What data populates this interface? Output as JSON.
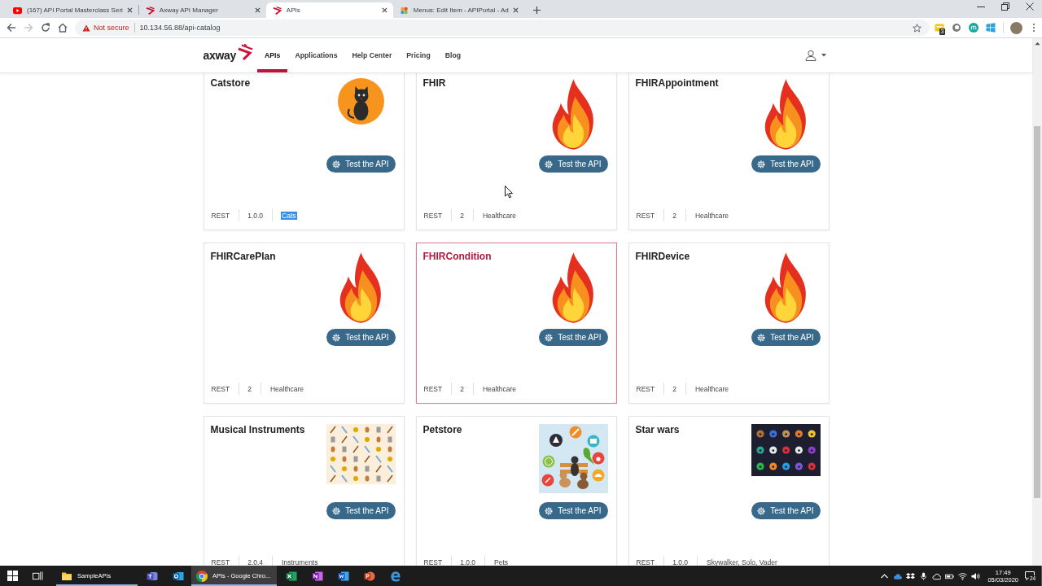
{
  "browser": {
    "tabs": [
      {
        "title": "(167) API Portal Masterclass Seri",
        "kind": "video",
        "selected": false
      },
      {
        "title": "Axway API Manager",
        "kind": "chevron",
        "selected": false
      },
      {
        "title": "APIs",
        "kind": "chevron",
        "selected": true
      },
      {
        "title": "Menus: Edit Item - APIPortal - Ad",
        "kind": "flower",
        "selected": false
      }
    ],
    "forward_disabled": true,
    "security": "Not secure",
    "url": "10.134.56.88/api-catalog",
    "extension_badge": "3"
  },
  "nav": {
    "brand": "axway",
    "items": [
      {
        "label": "APIs",
        "selected": true
      },
      {
        "label": "Applications",
        "selected": false
      },
      {
        "label": "Help Center",
        "selected": false
      },
      {
        "label": "Pricing",
        "selected": false
      },
      {
        "label": "Blog",
        "selected": false
      }
    ]
  },
  "cards": [
    {
      "title": "Catstore",
      "kind": "cat",
      "selected": false,
      "button": "Test the API",
      "type": "REST",
      "version": "1.0.0",
      "tag": "Cats",
      "tag_highlighted": true
    },
    {
      "title": "FHIR",
      "kind": "flame",
      "selected": false,
      "button": "Test the API",
      "type": "REST",
      "version": "2",
      "tag": "Healthcare",
      "tag_highlighted": false
    },
    {
      "title": "FHIRAppointment",
      "kind": "flame",
      "selected": false,
      "button": "Test the API",
      "type": "REST",
      "version": "2",
      "tag": "Healthcare",
      "tag_highlighted": false
    },
    {
      "title": "FHIRCarePlan",
      "kind": "flame",
      "selected": false,
      "button": "Test the API",
      "type": "REST",
      "version": "2",
      "tag": "Healthcare",
      "tag_highlighted": false
    },
    {
      "title": "FHIRCondition",
      "kind": "flame",
      "selected": true,
      "button": "Test the API",
      "type": "REST",
      "version": "2",
      "tag": "Healthcare",
      "tag_highlighted": false
    },
    {
      "title": "FHIRDevice",
      "kind": "flame",
      "selected": false,
      "button": "Test the API",
      "type": "REST",
      "version": "2",
      "tag": "Healthcare",
      "tag_highlighted": false
    },
    {
      "title": "Musical Instruments",
      "kind": "instruments",
      "selected": false,
      "button": "Test the API",
      "type": "REST",
      "version": "2.0.4",
      "tag": "Instruments",
      "tag_highlighted": false
    },
    {
      "title": "Petstore",
      "kind": "pets",
      "selected": false,
      "button": "Test the API",
      "type": "REST",
      "version": "1.0.0",
      "tag": "Pets",
      "tag_highlighted": false
    },
    {
      "title": "Star wars",
      "kind": "icons",
      "selected": false,
      "button": "Test the API",
      "type": "REST",
      "version": "1.0.0",
      "tag": "Skywalker, Solo, Vader",
      "tag_highlighted": false
    }
  ],
  "taskbar": {
    "apps": [
      {
        "kind": "folder",
        "label": "SampleAPIs",
        "selected": false,
        "running": true
      },
      {
        "kind": "chat",
        "selected": false,
        "running": false
      },
      {
        "kind": "mail",
        "selected": false,
        "running": false
      },
      {
        "kind": "chrome",
        "label": "APIs - Google Chro...",
        "selected": true,
        "running": true
      },
      {
        "kind": "spreadsheet",
        "selected": false,
        "running": false
      },
      {
        "kind": "notebook",
        "selected": false,
        "running": false
      },
      {
        "kind": "document",
        "selected": false,
        "running": false
      },
      {
        "kind": "slides",
        "selected": false,
        "running": false
      },
      {
        "kind": "edge",
        "selected": false,
        "running": false
      }
    ],
    "time": "17:49",
    "date": "05/03/2020",
    "notifications": "24"
  }
}
